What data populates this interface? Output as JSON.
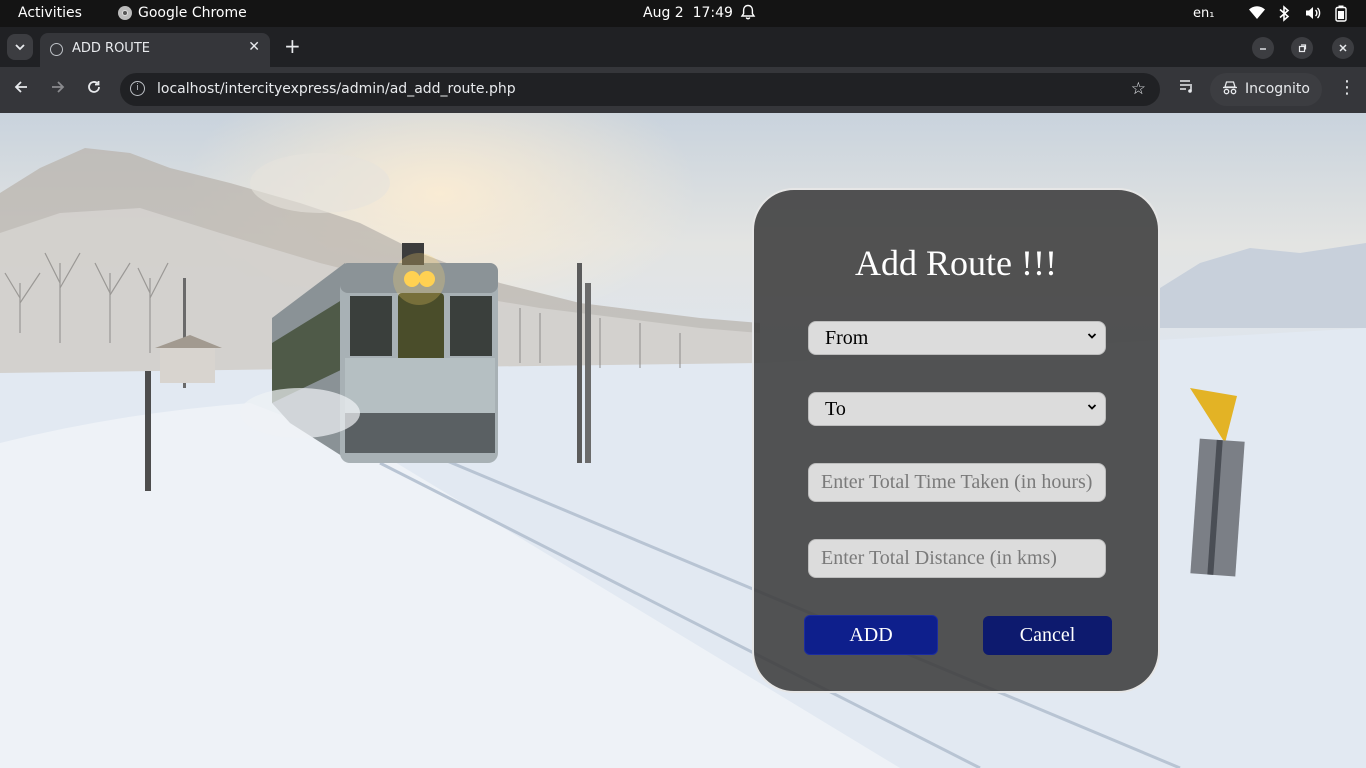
{
  "system_bar": {
    "activities": "Activities",
    "app_name": "Google Chrome",
    "date": "Aug 2",
    "time": "17:49",
    "language": "en₁"
  },
  "browser": {
    "tab_title": "ADD ROUTE",
    "url": "localhost/intercityexpress/admin/ad_add_route.php",
    "incognito_label": "Incognito"
  },
  "form": {
    "heading": "Add Route !!!",
    "from_select": {
      "selected": "From"
    },
    "to_select": {
      "selected": "To"
    },
    "time_input": {
      "value": "",
      "placeholder": "Enter Total Time Taken (in hours)"
    },
    "distance_input": {
      "value": "",
      "placeholder": "Enter Total Distance (in kms)"
    },
    "add_label": "ADD",
    "cancel_label": "Cancel"
  },
  "colors": {
    "add_button": "#0e1f8c",
    "cancel_button": "#0d1a6e",
    "card_background": "#3c3c3c"
  }
}
